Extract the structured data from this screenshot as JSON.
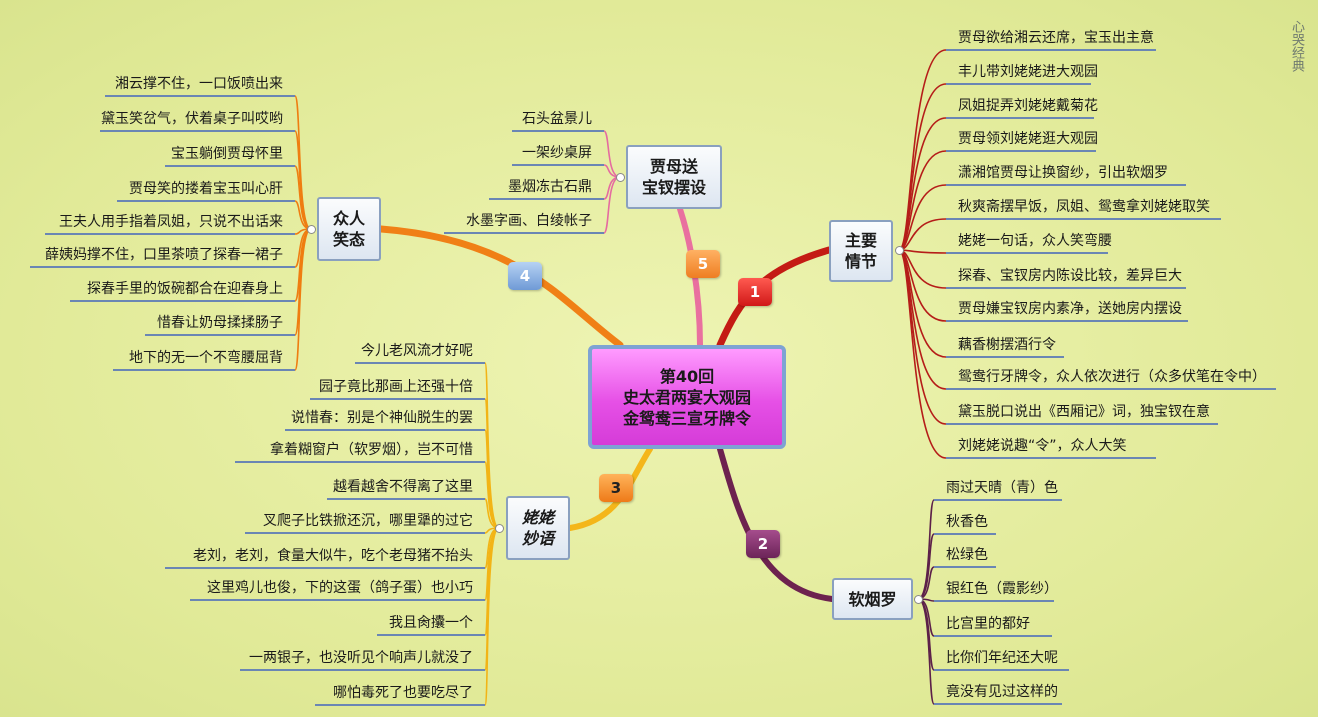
{
  "central": {
    "line1": "第40回",
    "line2": "史太君两宴大观园",
    "line3": "金鸳鸯三宣牙牌令"
  },
  "watermark": "心哭经典",
  "branches": {
    "b1": {
      "badge": "1",
      "label": "主要\n情节",
      "color": "#b51d19",
      "badge_color": "#e4222a",
      "items": [
        "贾母欲给湘云还席，宝玉出主意",
        "丰儿带刘姥姥进大观园",
        "凤姐捉弄刘姥姥戴菊花",
        "贾母领刘姥姥逛大观园",
        "潇湘馆贾母让换窗纱，引出软烟罗",
        "秋爽斋摆早饭，凤姐、鸳鸯拿刘姥姥取笑",
        "姥姥一句话，众人笑弯腰",
        "探春、宝钗房内陈设比较，差异巨大",
        "贾母嫌宝钗房内素净，送她房内摆设",
        "藕香榭摆酒行令",
        "鸳鸯行牙牌令，众人依次进行（众多伏笔在令中）",
        "黛玉脱口说出《西厢记》词，独宝钗在意",
        "刘姥姥说趣“令”，众人大笑"
      ]
    },
    "b2": {
      "badge": "2",
      "label": "软烟罗",
      "color": "#5c2049",
      "badge_color": "#7a2b66",
      "items": [
        "雨过天晴（青）色",
        "秋香色",
        "松绿色",
        "银红色（霞影纱）",
        "比宫里的都好",
        "比你们年纪还大呢",
        "竟没有见过这样的"
      ]
    },
    "b3": {
      "badge": "3",
      "label": "姥姥\n妙语",
      "color": "#f2b416",
      "badge_color": "#f28a1c",
      "items": [
        "今儿老风流才好呢",
        "园子竟比那画上还强十倍",
        "说惜春：别是个神仙脱生的罢",
        "拿着糊窗户（软罗烟），岂不可惜",
        "越看越舍不得离了这里",
        "叉爬子比铁掀还沉，哪里犟的过它",
        "老刘，老刘，食量大似牛，吃个老母猪不抬头",
        "这里鸡儿也俊，下的这蛋（鸽子蛋）也小巧",
        "我且肏攮一个",
        "一两银子，也没听见个响声儿就没了",
        "哪怕毒死了也要吃尽了"
      ]
    },
    "b4": {
      "badge": "4",
      "label": "众人\n笑态",
      "color": "#ef7d11",
      "badge_color": "#7aa6dd",
      "items": [
        "湘云撑不住，一口饭喷出来",
        "黛玉笑岔气，伏着桌子叫哎哟",
        "宝玉躺倒贾母怀里",
        "贾母笑的搂着宝玉叫心肝",
        "王夫人用手指着凤姐，只说不出话来",
        "薛姨妈撑不住，口里茶喷了探春一裙子",
        "探春手里的饭碗都合在迎春身上",
        "惜春让奶母揉揉肠子",
        "地下的无一个不弯腰屈背"
      ]
    },
    "b5": {
      "badge": "5",
      "label": "贾母送\n宝钗摆设",
      "color": "#e56ba0",
      "badge_color": "#f0883a",
      "items": [
        "石头盆景儿",
        "一架纱桌屏",
        "墨烟冻古石鼎",
        "水墨字画、白绫帐子"
      ]
    }
  }
}
